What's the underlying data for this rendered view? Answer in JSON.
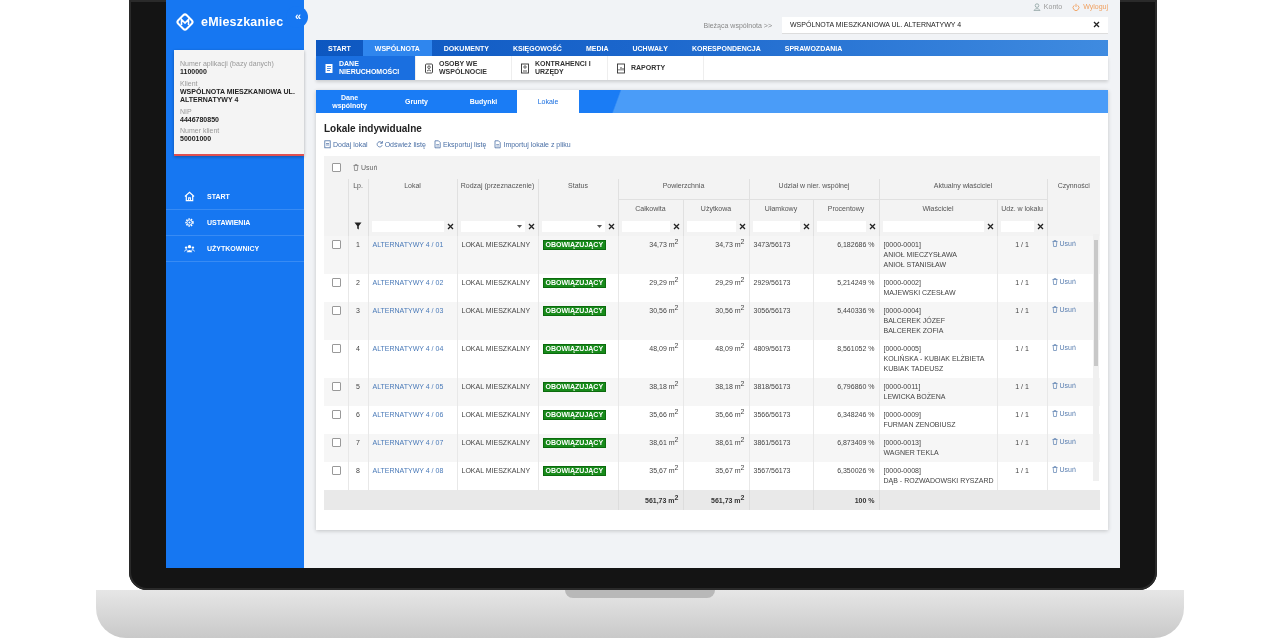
{
  "app": {
    "logo": "eMieszkaniec",
    "collapse": "«"
  },
  "client_card": {
    "fields": [
      {
        "label": "Numer aplikacji (bazy danych)",
        "value": "1100000"
      },
      {
        "label": "Klient",
        "value": "WSPÓLNOTA MIESZKANIOWA UL. ALTERNATYWY 4"
      },
      {
        "label": "NIP",
        "value": "4446780850"
      },
      {
        "label": "Numer klient",
        "value": "50001000"
      }
    ]
  },
  "sidebar": {
    "items": [
      {
        "label": "START",
        "kind": "home"
      },
      {
        "label": "USTAWIENIA",
        "kind": "gear"
      },
      {
        "label": "UŻYTKOWNICY",
        "kind": "users"
      }
    ]
  },
  "top_links": [
    {
      "label": "Konto",
      "kind": "account"
    },
    {
      "label": "Wyloguj",
      "kind": "logout"
    }
  ],
  "community_picker": {
    "label": "Bieżąca wspólnota >>",
    "value": "WSPÓLNOTA MIESZKANIOWA UL. ALTERNATYWY 4"
  },
  "main_nav": [
    {
      "label": "START",
      "selected": false
    },
    {
      "label": "WSPÓLNOTA",
      "selected": true
    },
    {
      "label": "DOKUMENTY",
      "selected": false
    },
    {
      "label": "KSIĘGOWOŚĆ",
      "selected": false
    },
    {
      "label": "MEDIA",
      "selected": false
    },
    {
      "label": "UCHWAŁY",
      "selected": false
    },
    {
      "label": "KORESPONDENCJA",
      "selected": false
    },
    {
      "label": "SPRAWOZDANIA",
      "selected": false
    }
  ],
  "sub_nav": [
    {
      "label": "DANE NIERUCHOMOŚCI",
      "kind": "building",
      "selected": true
    },
    {
      "label": "OSOBY WE WSPÓLNOCIE",
      "kind": "person",
      "selected": false
    },
    {
      "label": "KONTRAHENCI I URZĘDY",
      "kind": "contact",
      "selected": false
    },
    {
      "label": "RAPORTY",
      "kind": "report",
      "selected": false
    }
  ],
  "tabs": [
    {
      "label": "Dane wspólnoty",
      "selected": false
    },
    {
      "label": "Grunty",
      "selected": false
    },
    {
      "label": "Budynki",
      "selected": false
    },
    {
      "label": "Lokale",
      "selected": true
    }
  ],
  "panel": {
    "title": "Lokale indywidualne",
    "actions": [
      {
        "label": "Dodaj lokal",
        "kind": "add"
      },
      {
        "label": "Odśwież listę",
        "kind": "refresh"
      },
      {
        "label": "Eksportuj listę",
        "kind": "file"
      },
      {
        "label": "Importuj lokale z pliku",
        "kind": "file"
      }
    ]
  },
  "table": {
    "select_all_checked": false,
    "delete_button": "Usuń",
    "header_groups": [
      {
        "label": "Lp."
      },
      {
        "label": "Lokal"
      },
      {
        "label": "Rodzaj (przeznaczenie)"
      },
      {
        "label": "Status"
      },
      {
        "label": "Powierzchnia",
        "subcolumns": [
          "Całkowita",
          "Użytkowa"
        ]
      },
      {
        "label": "Udział w nier. wspólnej",
        "subcolumns": [
          "Ułamkowy",
          "Procentowy"
        ]
      },
      {
        "label": "Aktualny właściciel",
        "subcolumns": [
          "Właściciel",
          "Udz. w lokalu"
        ]
      },
      {
        "label": "Czynności"
      }
    ],
    "filters": [
      {
        "kind": "text"
      },
      {
        "kind": "select"
      },
      {
        "kind": "select"
      },
      {
        "kind": "text"
      },
      {
        "kind": "text"
      },
      {
        "kind": "text"
      },
      {
        "kind": "text"
      },
      {
        "kind": "text"
      },
      {
        "kind": "text"
      }
    ],
    "rows": [
      {
        "checked": false,
        "lp": "1",
        "lokal": "ALTERNATYWY 4 / 01",
        "rodzaj": "LOKAL MIESZKALNY",
        "status": "OBOWIĄZUJĄCY",
        "calkowita": "34,73 m$^{2}$",
        "uzytkowa": "34,73 m$^{2}$",
        "ulamkowy": "3473/56173",
        "procentowy": "6,182686 %",
        "owner": [
          "[0000-0001]",
          "ANIOŁ MIECZYSŁAWA",
          "ANIOŁ STANISŁAW"
        ],
        "udzial": "1 / 1",
        "action": "Usuń"
      },
      {
        "checked": false,
        "lp": "2",
        "lokal": "ALTERNATYWY 4 / 02",
        "rodzaj": "LOKAL MIESZKALNY",
        "status": "OBOWIĄZUJĄCY",
        "calkowita": "29,29 m$^{2}$",
        "uzytkowa": "29,29 m$^{2}$",
        "ulamkowy": "2929/56173",
        "procentowy": "5,214249 %",
        "owner": [
          "[0000-0002]",
          "MAJEWSKI CZESŁAW"
        ],
        "udzial": "1 / 1",
        "action": "Usuń"
      },
      {
        "checked": false,
        "lp": "3",
        "lokal": "ALTERNATYWY 4 / 03",
        "rodzaj": "LOKAL MIESZKALNY",
        "status": "OBOWIĄZUJĄCY",
        "calkowita": "30,56 m$^{2}$",
        "uzytkowa": "30,56 m$^{2}$",
        "ulamkowy": "3056/56173",
        "procentowy": "5,440336 %",
        "owner": [
          "[0000-0004]",
          "BALCEREK JÓZEF",
          "BALCEREK ZOFIA"
        ],
        "udzial": "1 / 1",
        "action": "Usuń"
      },
      {
        "checked": false,
        "lp": "4",
        "lokal": "ALTERNATYWY 4 / 04",
        "rodzaj": "LOKAL MIESZKALNY",
        "status": "OBOWIĄZUJĄCY",
        "calkowita": "48,09 m$^{2}$",
        "uzytkowa": "48,09 m$^{2}$",
        "ulamkowy": "4809/56173",
        "procentowy": "8,561052 %",
        "owner": [
          "[0000-0005]",
          "KOLIŃSKA - KUBIAK ELŻBIETA",
          "KUBIAK TADEUSZ"
        ],
        "udzial": "1 / 1",
        "action": "Usuń"
      },
      {
        "checked": false,
        "lp": "5",
        "lokal": "ALTERNATYWY 4 / 05",
        "rodzaj": "LOKAL MIESZKALNY",
        "status": "OBOWIĄZUJĄCY",
        "calkowita": "38,18 m$^{2}$",
        "uzytkowa": "38,18 m$^{2}$",
        "ulamkowy": "3818/56173",
        "procentowy": "6,796860 %",
        "owner": [
          "[0000-0011]",
          "LEWICKA BOŻENA"
        ],
        "udzial": "1 / 1",
        "action": "Usuń"
      },
      {
        "checked": false,
        "lp": "6",
        "lokal": "ALTERNATYWY 4 / 06",
        "rodzaj": "LOKAL MIESZKALNY",
        "status": "OBOWIĄZUJĄCY",
        "calkowita": "35,66 m$^{2}$",
        "uzytkowa": "35,66 m$^{2}$",
        "ulamkowy": "3566/56173",
        "procentowy": "6,348246 %",
        "owner": [
          "[0000-0009]",
          "FURMAN ZENOBIUSZ"
        ],
        "udzial": "1 / 1",
        "action": "Usuń"
      },
      {
        "checked": false,
        "lp": "7",
        "lokal": "ALTERNATYWY 4 / 07",
        "rodzaj": "LOKAL MIESZKALNY",
        "status": "OBOWIĄZUJĄCY",
        "calkowita": "38,61 m$^{2}$",
        "uzytkowa": "38,61 m$^{2}$",
        "ulamkowy": "3861/56173",
        "procentowy": "6,873409 %",
        "owner": [
          "[0000-0013]",
          "WAGNER TEKLA"
        ],
        "udzial": "1 / 1",
        "action": "Usuń"
      },
      {
        "checked": false,
        "lp": "8",
        "lokal": "ALTERNATYWY 4 / 08",
        "rodzaj": "LOKAL MIESZKALNY",
        "status": "OBOWIĄZUJĄCY",
        "calkowita": "35,67 m$^{2}$",
        "uzytkowa": "35,67 m$^{2}$",
        "ulamkowy": "3567/56173",
        "procentowy": "6,350026 %",
        "owner": [
          "[0000-0008]",
          "DĄB - ROZWADOWSKI RYSZARD"
        ],
        "udzial": "1 / 1",
        "action": "Usuń"
      }
    ],
    "totals": {
      "calkowita": "561,73 m$^{2}$",
      "uzytkowa": "561,73 m$^{2}$",
      "procentowy": "100 %"
    }
  }
}
